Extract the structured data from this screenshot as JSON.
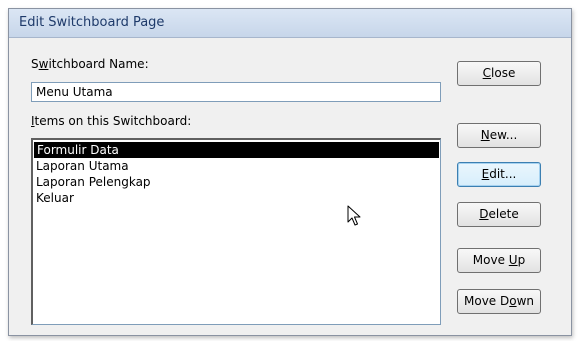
{
  "window": {
    "title": "Edit Switchboard Page"
  },
  "switchboard_name": {
    "label_pre": "S",
    "label_ul": "w",
    "label_post": "itchboard Name:",
    "value": "Menu Utama"
  },
  "items_section": {
    "label_ul": "I",
    "label_post": "tems on this Switchboard:",
    "items": [
      {
        "label": "Formulir Data",
        "selected": true
      },
      {
        "label": "Laporan Utama",
        "selected": false
      },
      {
        "label": "Laporan Pelengkap",
        "selected": false
      },
      {
        "label": "Keluar",
        "selected": false
      }
    ]
  },
  "buttons": {
    "close": {
      "pre": "",
      "ul": "C",
      "post": "lose"
    },
    "new": {
      "pre": "",
      "ul": "N",
      "post": "ew..."
    },
    "edit": {
      "pre": "",
      "ul": "E",
      "post": "dit..."
    },
    "delete": {
      "pre": "",
      "ul": "D",
      "post": "elete"
    },
    "move_up": {
      "pre": "Move ",
      "ul": "U",
      "post": "p"
    },
    "move_down": {
      "pre": "Move D",
      "ul": "o",
      "post": "wn"
    }
  },
  "icons": {
    "cursor": "mouse-pointer-icon"
  }
}
